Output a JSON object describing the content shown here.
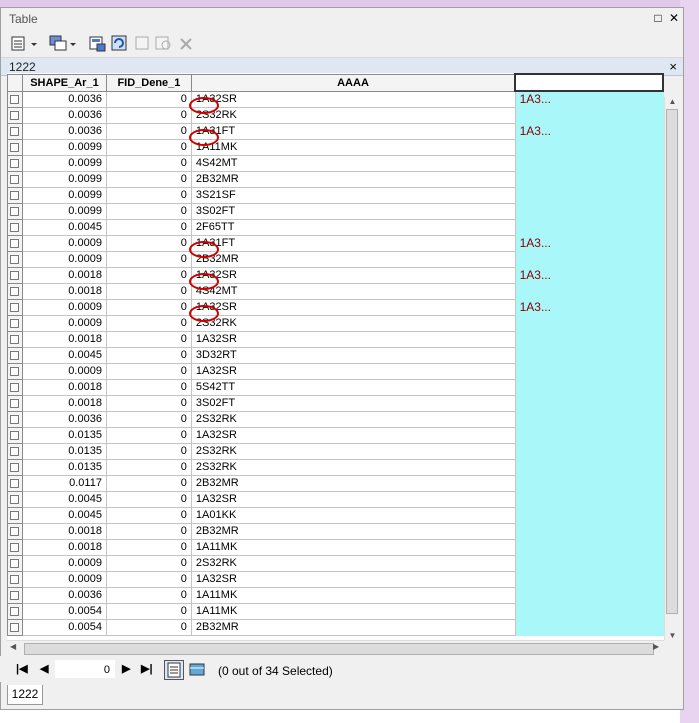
{
  "window": {
    "title": "Table",
    "minimize_icon": "window-min-icon",
    "close_icon": "window-close-icon"
  },
  "toolbar": {
    "tools": [
      {
        "name": "table-options-icon"
      },
      {
        "name": "related-tables-icon"
      },
      {
        "name": "select-by-attributes-icon"
      },
      {
        "name": "switch-selection-icon"
      },
      {
        "name": "clear-selection-icon"
      },
      {
        "name": "zoom-to-selected-icon"
      },
      {
        "name": "delete-selected-icon"
      }
    ]
  },
  "tab": {
    "name": "1222",
    "close": "×"
  },
  "columns": [
    "SHAPE_Ar_1",
    "FID_Dene_1",
    "AAAA",
    ""
  ],
  "rows": [
    [
      "0.0036",
      "0",
      "1A32SR",
      "1A3..."
    ],
    [
      "0.0036",
      "0",
      "2S32RK",
      ""
    ],
    [
      "0.0036",
      "0",
      "1A31FT",
      "1A3..."
    ],
    [
      "0.0099",
      "0",
      "1A11MK",
      ""
    ],
    [
      "0.0099",
      "0",
      "4S42MT",
      ""
    ],
    [
      "0.0099",
      "0",
      "2B32MR",
      ""
    ],
    [
      "0.0099",
      "0",
      "3S21SF",
      ""
    ],
    [
      "0.0099",
      "0",
      "3S02FT",
      ""
    ],
    [
      "0.0045",
      "0",
      "2F65TT",
      ""
    ],
    [
      "0.0009",
      "0",
      "1A31FT",
      "1A3..."
    ],
    [
      "0.0009",
      "0",
      "2B32MR",
      ""
    ],
    [
      "0.0018",
      "0",
      "1A32SR",
      "1A3..."
    ],
    [
      "0.0018",
      "0",
      "4S42MT",
      ""
    ],
    [
      "0.0009",
      "0",
      "1A32SR",
      "1A3..."
    ],
    [
      "0.0009",
      "0",
      "2S32RK",
      ""
    ],
    [
      "0.0018",
      "0",
      "1A32SR",
      ""
    ],
    [
      "0.0045",
      "0",
      "3D32RT",
      ""
    ],
    [
      "0.0009",
      "0",
      "1A32SR",
      ""
    ],
    [
      "0.0018",
      "0",
      "5S42TT",
      ""
    ],
    [
      "0.0018",
      "0",
      "3S02FT",
      ""
    ],
    [
      "0.0036",
      "0",
      "2S32RK",
      ""
    ],
    [
      "0.0135",
      "0",
      "1A32SR",
      ""
    ],
    [
      "0.0135",
      "0",
      "2S32RK",
      ""
    ],
    [
      "0.0135",
      "0",
      "2S32RK",
      ""
    ],
    [
      "0.0117",
      "0",
      "2B32MR",
      ""
    ],
    [
      "0.0045",
      "0",
      "1A32SR",
      ""
    ],
    [
      "0.0045",
      "0",
      "1A01KK",
      ""
    ],
    [
      "0.0018",
      "0",
      "2B32MR",
      ""
    ],
    [
      "0.0018",
      "0",
      "1A11MK",
      ""
    ],
    [
      "0.0009",
      "0",
      "2S32RK",
      ""
    ],
    [
      "0.0009",
      "0",
      "1A32SR",
      ""
    ],
    [
      "0.0036",
      "0",
      "1A11MK",
      ""
    ],
    [
      "0.0054",
      "0",
      "1A11MK",
      ""
    ],
    [
      "0.0054",
      "0",
      "2B32MR",
      ""
    ]
  ],
  "circled_rows": [
    0,
    2,
    9,
    11,
    13
  ],
  "nav": {
    "record": "0",
    "status": "(0 out of 34 Selected)"
  },
  "bottom_tab": "1222",
  "colors": {
    "highlight_column": "#aaf7fa",
    "annotation_circle": "#d00000",
    "annotation_text": "#8b0000"
  }
}
